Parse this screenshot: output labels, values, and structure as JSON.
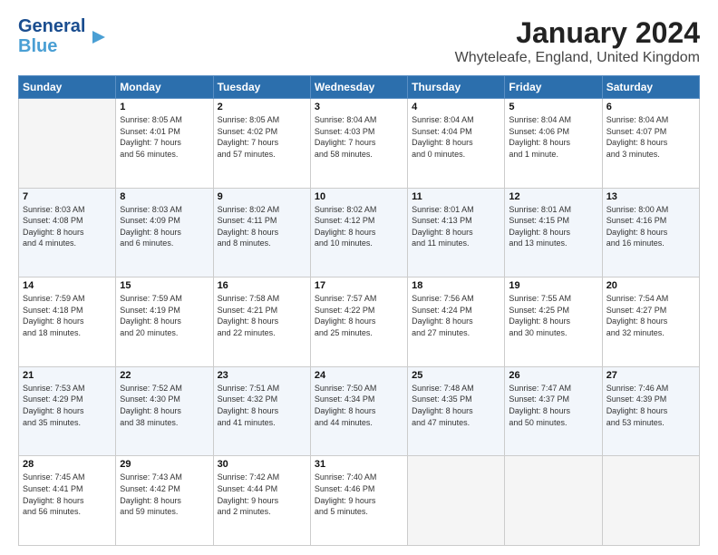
{
  "logo": {
    "line1": "General",
    "line2": "Blue"
  },
  "title": "January 2024",
  "subtitle": "Whyteleafe, England, United Kingdom",
  "weekdays": [
    "Sunday",
    "Monday",
    "Tuesday",
    "Wednesday",
    "Thursday",
    "Friday",
    "Saturday"
  ],
  "weeks": [
    [
      {
        "day": "",
        "info": ""
      },
      {
        "day": "1",
        "info": "Sunrise: 8:05 AM\nSunset: 4:01 PM\nDaylight: 7 hours\nand 56 minutes."
      },
      {
        "day": "2",
        "info": "Sunrise: 8:05 AM\nSunset: 4:02 PM\nDaylight: 7 hours\nand 57 minutes."
      },
      {
        "day": "3",
        "info": "Sunrise: 8:04 AM\nSunset: 4:03 PM\nDaylight: 7 hours\nand 58 minutes."
      },
      {
        "day": "4",
        "info": "Sunrise: 8:04 AM\nSunset: 4:04 PM\nDaylight: 8 hours\nand 0 minutes."
      },
      {
        "day": "5",
        "info": "Sunrise: 8:04 AM\nSunset: 4:06 PM\nDaylight: 8 hours\nand 1 minute."
      },
      {
        "day": "6",
        "info": "Sunrise: 8:04 AM\nSunset: 4:07 PM\nDaylight: 8 hours\nand 3 minutes."
      }
    ],
    [
      {
        "day": "7",
        "info": "Sunrise: 8:03 AM\nSunset: 4:08 PM\nDaylight: 8 hours\nand 4 minutes."
      },
      {
        "day": "8",
        "info": "Sunrise: 8:03 AM\nSunset: 4:09 PM\nDaylight: 8 hours\nand 6 minutes."
      },
      {
        "day": "9",
        "info": "Sunrise: 8:02 AM\nSunset: 4:11 PM\nDaylight: 8 hours\nand 8 minutes."
      },
      {
        "day": "10",
        "info": "Sunrise: 8:02 AM\nSunset: 4:12 PM\nDaylight: 8 hours\nand 10 minutes."
      },
      {
        "day": "11",
        "info": "Sunrise: 8:01 AM\nSunset: 4:13 PM\nDaylight: 8 hours\nand 11 minutes."
      },
      {
        "day": "12",
        "info": "Sunrise: 8:01 AM\nSunset: 4:15 PM\nDaylight: 8 hours\nand 13 minutes."
      },
      {
        "day": "13",
        "info": "Sunrise: 8:00 AM\nSunset: 4:16 PM\nDaylight: 8 hours\nand 16 minutes."
      }
    ],
    [
      {
        "day": "14",
        "info": "Sunrise: 7:59 AM\nSunset: 4:18 PM\nDaylight: 8 hours\nand 18 minutes."
      },
      {
        "day": "15",
        "info": "Sunrise: 7:59 AM\nSunset: 4:19 PM\nDaylight: 8 hours\nand 20 minutes."
      },
      {
        "day": "16",
        "info": "Sunrise: 7:58 AM\nSunset: 4:21 PM\nDaylight: 8 hours\nand 22 minutes."
      },
      {
        "day": "17",
        "info": "Sunrise: 7:57 AM\nSunset: 4:22 PM\nDaylight: 8 hours\nand 25 minutes."
      },
      {
        "day": "18",
        "info": "Sunrise: 7:56 AM\nSunset: 4:24 PM\nDaylight: 8 hours\nand 27 minutes."
      },
      {
        "day": "19",
        "info": "Sunrise: 7:55 AM\nSunset: 4:25 PM\nDaylight: 8 hours\nand 30 minutes."
      },
      {
        "day": "20",
        "info": "Sunrise: 7:54 AM\nSunset: 4:27 PM\nDaylight: 8 hours\nand 32 minutes."
      }
    ],
    [
      {
        "day": "21",
        "info": "Sunrise: 7:53 AM\nSunset: 4:29 PM\nDaylight: 8 hours\nand 35 minutes."
      },
      {
        "day": "22",
        "info": "Sunrise: 7:52 AM\nSunset: 4:30 PM\nDaylight: 8 hours\nand 38 minutes."
      },
      {
        "day": "23",
        "info": "Sunrise: 7:51 AM\nSunset: 4:32 PM\nDaylight: 8 hours\nand 41 minutes."
      },
      {
        "day": "24",
        "info": "Sunrise: 7:50 AM\nSunset: 4:34 PM\nDaylight: 8 hours\nand 44 minutes."
      },
      {
        "day": "25",
        "info": "Sunrise: 7:48 AM\nSunset: 4:35 PM\nDaylight: 8 hours\nand 47 minutes."
      },
      {
        "day": "26",
        "info": "Sunrise: 7:47 AM\nSunset: 4:37 PM\nDaylight: 8 hours\nand 50 minutes."
      },
      {
        "day": "27",
        "info": "Sunrise: 7:46 AM\nSunset: 4:39 PM\nDaylight: 8 hours\nand 53 minutes."
      }
    ],
    [
      {
        "day": "28",
        "info": "Sunrise: 7:45 AM\nSunset: 4:41 PM\nDaylight: 8 hours\nand 56 minutes."
      },
      {
        "day": "29",
        "info": "Sunrise: 7:43 AM\nSunset: 4:42 PM\nDaylight: 8 hours\nand 59 minutes."
      },
      {
        "day": "30",
        "info": "Sunrise: 7:42 AM\nSunset: 4:44 PM\nDaylight: 9 hours\nand 2 minutes."
      },
      {
        "day": "31",
        "info": "Sunrise: 7:40 AM\nSunset: 4:46 PM\nDaylight: 9 hours\nand 5 minutes."
      },
      {
        "day": "",
        "info": ""
      },
      {
        "day": "",
        "info": ""
      },
      {
        "day": "",
        "info": ""
      }
    ]
  ]
}
